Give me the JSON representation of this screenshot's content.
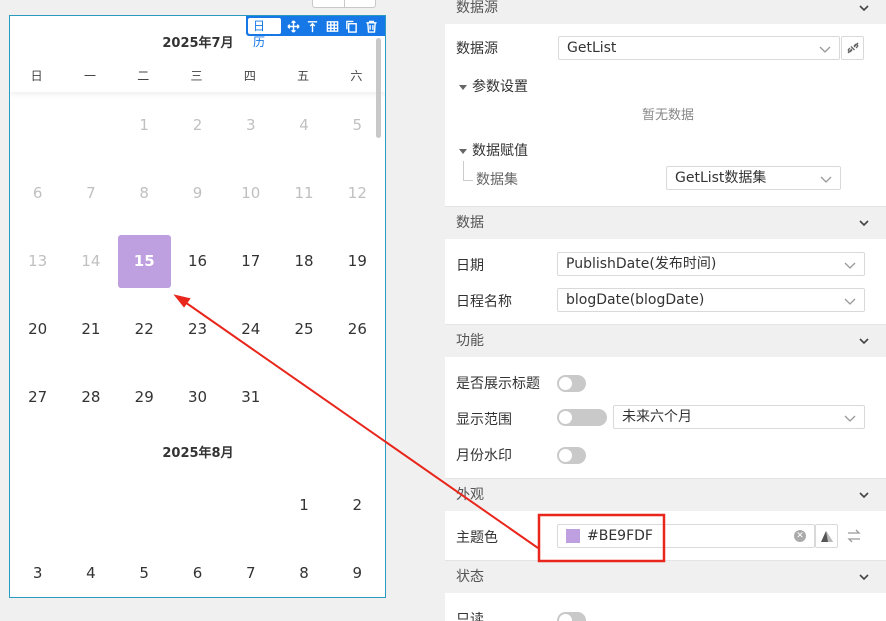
{
  "calendar": {
    "toolbar_tag": "日历",
    "month1_title": "2025年7月",
    "month2_title": "2025年8月",
    "weekdays": [
      "日",
      "一",
      "二",
      "三",
      "四",
      "五",
      "六"
    ],
    "july_rows": [
      [
        "",
        "",
        "1",
        "2",
        "3",
        "4",
        "5"
      ],
      [
        "6",
        "7",
        "8",
        "9",
        "10",
        "11",
        "12"
      ],
      [
        "13",
        "14",
        "15",
        "16",
        "17",
        "18",
        "19"
      ],
      [
        "20",
        "21",
        "22",
        "23",
        "24",
        "25",
        "26"
      ],
      [
        "27",
        "28",
        "29",
        "30",
        "31",
        "",
        ""
      ]
    ],
    "august_rows": [
      [
        "",
        "",
        "",
        "",
        "",
        "1",
        "2"
      ],
      [
        "3",
        "4",
        "5",
        "6",
        "7",
        "8",
        "9"
      ]
    ],
    "selected_day": "15",
    "selected_color": "#BE9FDF"
  },
  "panel": {
    "datasource_section": "数据源",
    "datasource_label": "数据源",
    "datasource_value": "GetList",
    "params_label": "参数设置",
    "params_empty": "暂无数据",
    "assign_label": "数据赋值",
    "dataset_label": "数据集",
    "dataset_value": "GetList数据集",
    "data_section": "数据",
    "date_label": "日期",
    "date_value": "PublishDate(发布时间)",
    "schedule_label": "日程名称",
    "schedule_value": "blogDate(blogDate)",
    "feature_section": "功能",
    "show_title_label": "是否展示标题",
    "range_label": "显示范围",
    "range_value": "未来六个月",
    "watermark_label": "月份水印",
    "look_section": "外观",
    "theme_label": "主题色",
    "theme_value": "#BE9FDF",
    "state_section": "状态",
    "readonly_label": "只读"
  },
  "annotation_color": "#e8261b"
}
